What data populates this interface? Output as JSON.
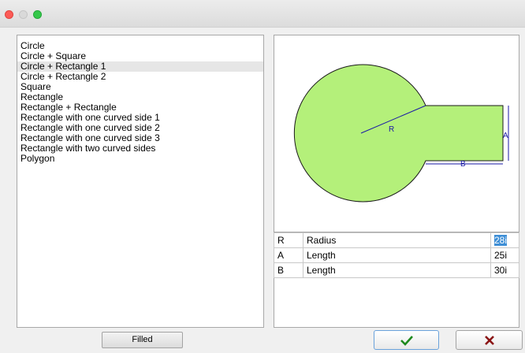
{
  "window": {
    "traffic_lights": [
      "close",
      "minimize",
      "maximize"
    ]
  },
  "shapes": {
    "items": [
      "Circle",
      "Circle + Square",
      "Circle + Rectangle 1",
      "Circle + Rectangle 2",
      "Square",
      "Rectangle",
      "Rectangle + Rectangle",
      "Rectangle with one curved side 1",
      "Rectangle with one curved side 2",
      "Rectangle with one curved side 3",
      "Rectangle with two curved sides",
      "Polygon"
    ],
    "selected": "Circle + Rectangle 1"
  },
  "filled_button": {
    "label": "Filled"
  },
  "preview": {
    "labels": {
      "radius": "R",
      "height": "A",
      "length": "B"
    },
    "fill_color": "#b4f07a",
    "dimension_color": "#1a1aa6"
  },
  "params": {
    "rows": [
      {
        "key": "R",
        "name": "Radius",
        "value": "28i"
      },
      {
        "key": "A",
        "name": "Length",
        "value": "25i"
      },
      {
        "key": "B",
        "name": "Length",
        "value": "30i"
      }
    ]
  },
  "ok_button": {
    "icon": "checkmark-icon",
    "color": "#1e8a1e"
  },
  "cancel_button": {
    "icon": "x-icon",
    "color": "#8a1010"
  }
}
